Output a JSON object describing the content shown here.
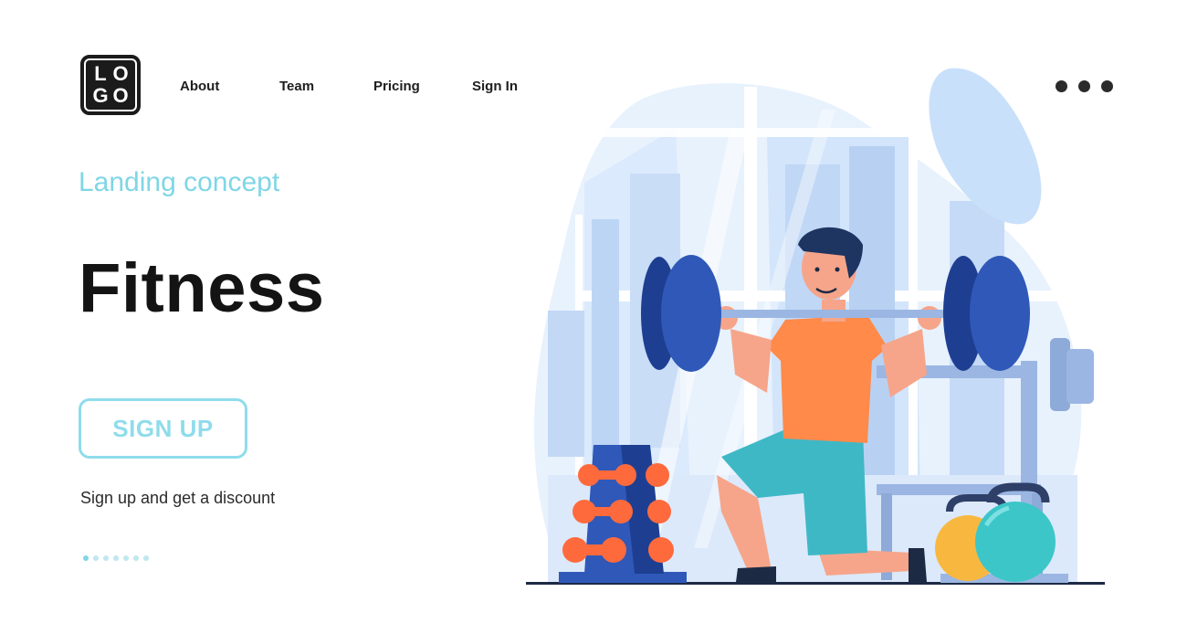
{
  "logo": {
    "letters": [
      "L",
      "O",
      "G",
      "O"
    ]
  },
  "nav": {
    "items": [
      {
        "label": "About"
      },
      {
        "label": "Team"
      },
      {
        "label": "Pricing"
      },
      {
        "label": "Sign In"
      }
    ]
  },
  "menu_dots": {
    "icon": "more-dots-icon",
    "count": 3,
    "color": "#2b2b2b"
  },
  "hero": {
    "subtitle": "Landing concept",
    "title": "Fitness",
    "cta_label": "SIGN UP",
    "note": "Sign up and get a discount"
  },
  "pager": {
    "count": 7,
    "active_index": 0
  },
  "colors": {
    "accent": "#7fd6e6",
    "title": "#141414",
    "plate_blue": "#2f58b8",
    "shirt_orange": "#ff8a4a",
    "shorts_teal": "#3fb8c6",
    "kettlebell_yellow": "#f8b840",
    "kettlebell_teal": "#3cc6c8"
  },
  "illustration": {
    "icons": [
      "window-blob-icon",
      "barbell-icon",
      "athlete-icon",
      "dumbbell-rack-icon",
      "squat-rack-icon",
      "kettlebell-icon"
    ]
  }
}
